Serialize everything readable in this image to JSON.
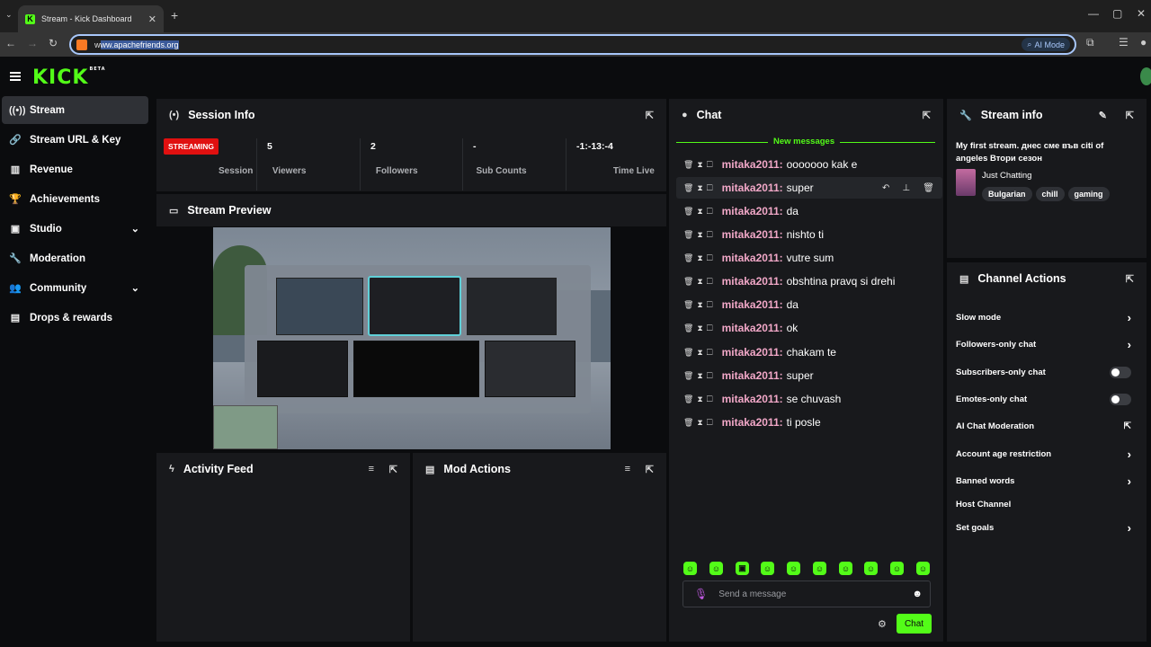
{
  "browser": {
    "tab_title": "Stream - Kick Dashboard",
    "url_prefix": "w",
    "url_selected": "ww.apachefriends.org",
    "ai_mode_label": "AI Mode"
  },
  "logo": {
    "text": "KICK",
    "badge": "BETA"
  },
  "sidebar": {
    "items": [
      {
        "label": "Stream",
        "icon": "broadcast-icon"
      },
      {
        "label": "Stream URL & Key",
        "icon": "link-icon"
      },
      {
        "label": "Revenue",
        "icon": "chart-icon"
      },
      {
        "label": "Achievements",
        "icon": "trophy-icon"
      },
      {
        "label": "Studio",
        "icon": "studio-icon"
      },
      {
        "label": "Moderation",
        "icon": "wrench-icon"
      },
      {
        "label": "Community",
        "icon": "people-icon"
      },
      {
        "label": "Drops & rewards",
        "icon": "gift-icon"
      }
    ]
  },
  "session": {
    "title": "Session Info",
    "status_badge": "STREAMING",
    "status_label": "Session",
    "stats": [
      {
        "value": "5",
        "label": "Viewers"
      },
      {
        "value": "2",
        "label": "Followers"
      },
      {
        "value": "-",
        "label": "Sub Counts"
      },
      {
        "value": "-1:-13:-4",
        "label": "Time Live"
      }
    ]
  },
  "preview": {
    "title": "Stream Preview"
  },
  "activity": {
    "title": "Activity Feed"
  },
  "mod_actions": {
    "title": "Mod Actions"
  },
  "chat": {
    "title": "Chat",
    "new_messages": "New messages",
    "messages": [
      {
        "user": "mitaka2011:",
        "text": "ooooooo kak e"
      },
      {
        "user": "mitaka2011:",
        "text": "super"
      },
      {
        "user": "mitaka2011:",
        "text": "da"
      },
      {
        "user": "mitaka2011:",
        "text": "nishto ti"
      },
      {
        "user": "mitaka2011:",
        "text": "vutre sum"
      },
      {
        "user": "mitaka2011:",
        "text": "obshtina pravq si drehi"
      },
      {
        "user": "mitaka2011:",
        "text": "da"
      },
      {
        "user": "mitaka2011:",
        "text": "ok"
      },
      {
        "user": "mitaka2011:",
        "text": "chakam te"
      },
      {
        "user": "mitaka2011:",
        "text": "super"
      },
      {
        "user": "mitaka2011:",
        "text": "se chuvash"
      },
      {
        "user": "mitaka2011:",
        "text": "ti posle"
      }
    ],
    "input_placeholder": "Send a message",
    "send_label": "Chat"
  },
  "stream_info": {
    "title": "Stream info",
    "stream_title": "My first stream. днес сме във citi of angeles Втори сезон",
    "category": "Just Chatting",
    "tags": [
      "Bulgarian",
      "chill",
      "gaming"
    ]
  },
  "channel_actions": {
    "title": "Channel Actions",
    "items": [
      {
        "label": "Slow mode",
        "control": "chevron"
      },
      {
        "label": "Followers-only chat",
        "control": "chevron"
      },
      {
        "label": "Subscribers-only chat",
        "control": "toggle",
        "on": false
      },
      {
        "label": "Emotes-only chat",
        "control": "toggle",
        "on": false
      },
      {
        "label": "AI Chat Moderation",
        "control": "external"
      },
      {
        "label": "Account age restriction",
        "control": "chevron"
      },
      {
        "label": "Banned words",
        "control": "chevron"
      },
      {
        "label": "Host Channel",
        "control": "none"
      },
      {
        "label": "Set goals",
        "control": "chevron"
      }
    ]
  },
  "colors": {
    "accent": "#53fc18",
    "panel": "#18191c",
    "background": "#0b0c0e",
    "username": "#f2a8c8",
    "streaming_badge": "#e01010"
  }
}
